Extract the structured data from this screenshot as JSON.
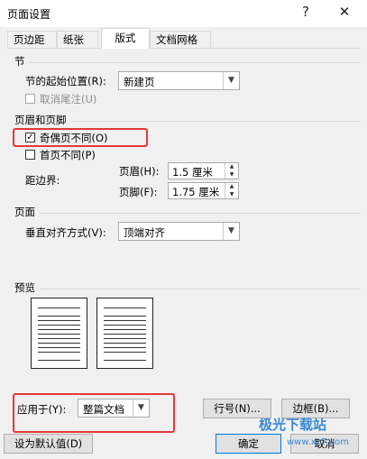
{
  "window": {
    "title": "页面设置",
    "help": "?",
    "close": "✕"
  },
  "tabs": [
    {
      "label": "页边距"
    },
    {
      "label": "纸张"
    },
    {
      "label": "版式"
    },
    {
      "label": "文档网格"
    }
  ],
  "section_section": {
    "title": "节",
    "start_label": "节的起始位置(R):",
    "start_value": "新建页",
    "suppress_endnotes": "取消尾注(U)"
  },
  "header_footer": {
    "title": "页眉和页脚",
    "odd_even_label": "奇偶页不同(O)",
    "odd_even_checked": "✓",
    "first_page_label": "首页不同(P)",
    "margin_label": "距边界:",
    "header_label": "页眉(H):",
    "header_value": "1.5 厘米",
    "footer_label": "页脚(F):",
    "footer_value": "1.75 厘米"
  },
  "page_section": {
    "title": "页面",
    "valign_label": "垂直对齐方式(V):",
    "valign_value": "顶端对齐"
  },
  "preview": {
    "title": "预览",
    "apply_label": "应用于(Y):",
    "apply_value": "整篇文档",
    "line_numbers": "行号(N)...",
    "borders": "边框(B)..."
  },
  "footer": {
    "set_default": "设为默认值(D)",
    "ok": "确定",
    "cancel": "取消"
  },
  "watermark": {
    "name": "极光下载站",
    "url": "www.xz7.com"
  },
  "colors": {
    "highlight": "#e53935",
    "accent": "#0078d7"
  }
}
